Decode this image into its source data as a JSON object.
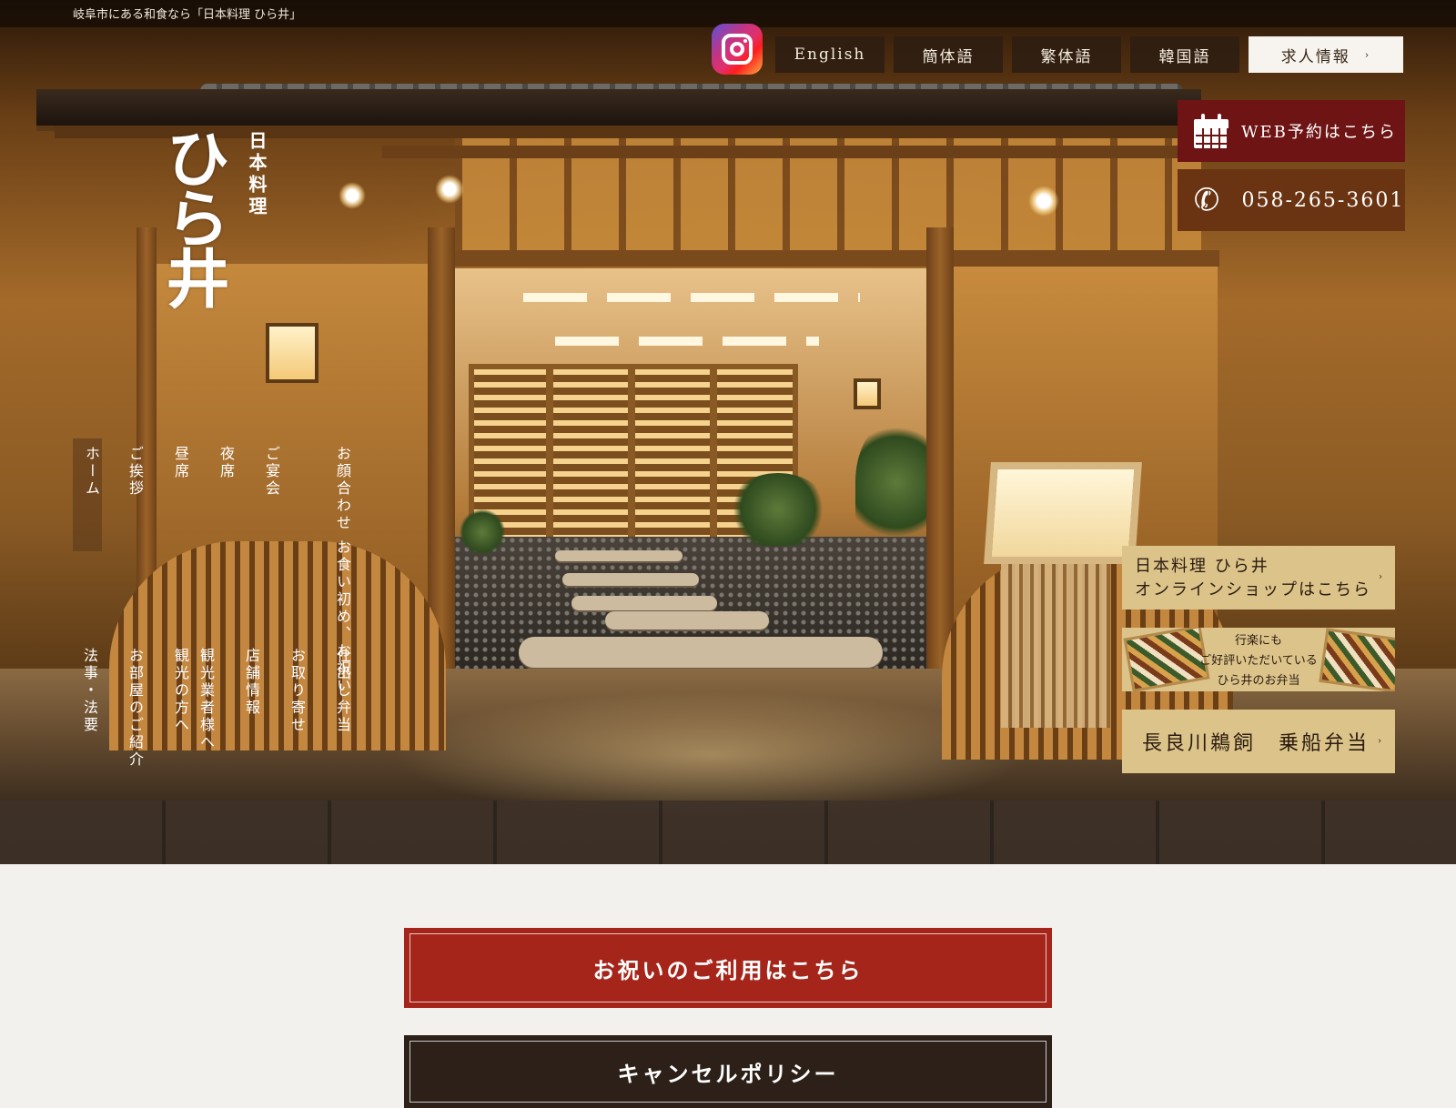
{
  "header": {
    "tagline": "岐阜市にある和食なら「日本料理 ひら井」",
    "instagram_icon": "instagram-icon",
    "languages": [
      "English",
      "簡体語",
      "繁体語",
      "韓国語"
    ],
    "recruit_label": "求人情報",
    "recruit_chevron": "›"
  },
  "logo": {
    "main": "ひら井",
    "sub": "日本料理"
  },
  "cta": {
    "web_reserve": "WEB予約はこちら",
    "phone": "058-265-3601"
  },
  "nav": {
    "row1": [
      "お顔合わせ お食い初め、お祝い",
      "ご宴会",
      "夜席",
      "昼席",
      "ご挨拶",
      "ホーム"
    ],
    "row2": [
      "仕出し弁当",
      "お取り寄せ",
      "店舗情報",
      "観光業者様へ",
      "観光の方へ",
      "お部屋のご紹介",
      "法事・法要"
    ]
  },
  "side_links": {
    "shop_line1": "日本料理 ひら井",
    "shop_line2": "オンラインショップはこちら",
    "bento_line1": "行楽にも",
    "bento_line2": "ご好評いただいている",
    "bento_line3": "ひら井のお弁当",
    "ukai": "長良川鵜飼　乗船弁当",
    "chevron": "›"
  },
  "buttons": {
    "celebrate": "お祝いのご利用はこちら",
    "cancel": "キャンセルポリシー"
  },
  "colors": {
    "dark_red": "#6e1414",
    "brown": "#6a3412",
    "gold": "#dcc38a",
    "celebrate_red": "#a5251a",
    "dark": "#2d2019"
  }
}
